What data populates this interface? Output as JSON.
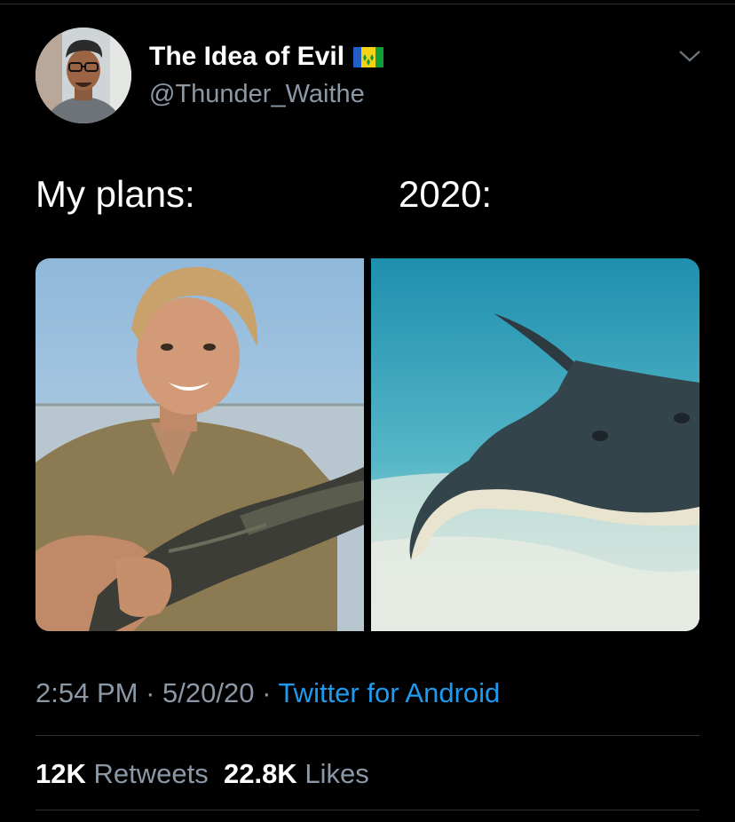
{
  "tweet": {
    "author": {
      "display_name": "The Idea of Evil",
      "handle": "@Thunder_Waithe",
      "avatar_icon": "user-avatar-photo",
      "flag_icon": "saint-vincent-flag-icon"
    },
    "menu_icon": "chevron-down-icon",
    "captions": {
      "left": "My plans:",
      "right": "2020:"
    },
    "media": [
      {
        "icon": "man-holding-crocodile-photo"
      },
      {
        "icon": "stingray-underwater-photo"
      }
    ],
    "meta": {
      "time": "2:54 PM",
      "separator": " · ",
      "date": "5/20/20",
      "source": "Twitter for Android"
    },
    "stats": {
      "retweets_count": "12K",
      "retweets_label": "Retweets",
      "likes_count": "22.8K",
      "likes_label": "Likes"
    }
  },
  "colors": {
    "background": "#000000",
    "text_primary": "#ffffff",
    "text_secondary": "#8b98a5",
    "link": "#1d9bf0",
    "divider": "#2f3336"
  }
}
